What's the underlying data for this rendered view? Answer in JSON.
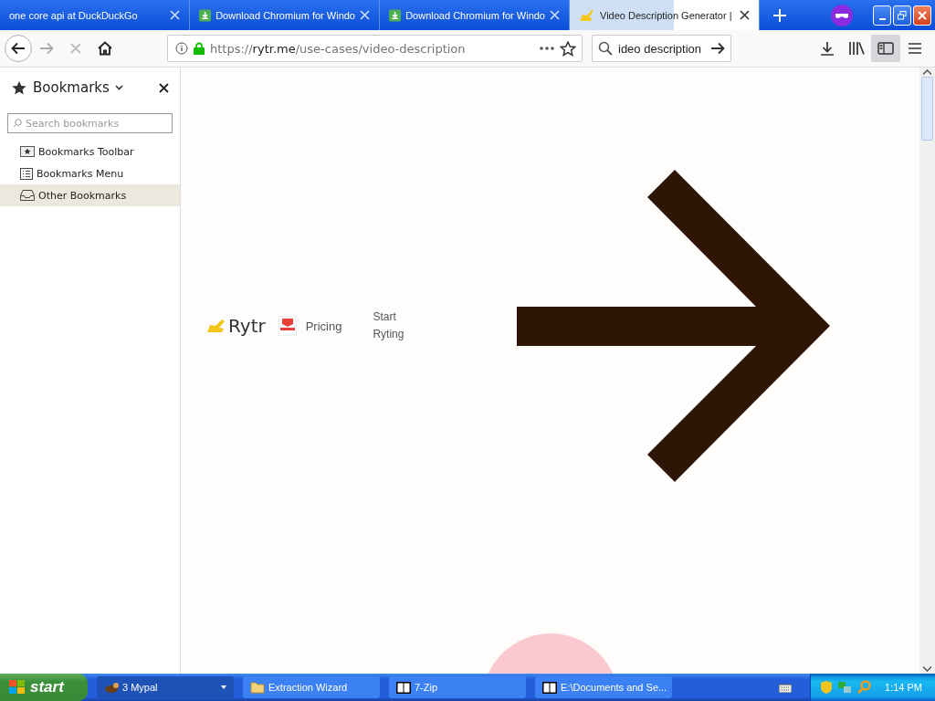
{
  "tabs": [
    {
      "title": "one core api at DuckDuckGo",
      "kind": "plain",
      "selected": false
    },
    {
      "title": "Download Chromium for Windo",
      "kind": "download",
      "selected": false
    },
    {
      "title": "Download Chromium for Windo",
      "kind": "download",
      "selected": false
    },
    {
      "title": "Video Description Generator |",
      "kind": "pen",
      "selected": true
    }
  ],
  "toolbar": {
    "url_host": "https://rytr.me",
    "url_path": "/use-cases/video-description",
    "search_value": "ideo description",
    "sidebar_on": true
  },
  "sidebar": {
    "title": "Bookmarks",
    "search": {
      "placeholder": "Search bookmarks"
    },
    "items": [
      {
        "label": "Bookmarks Toolbar",
        "kind": "toolbar",
        "selected": false
      },
      {
        "label": "Bookmarks Menu",
        "kind": "menu",
        "selected": false
      },
      {
        "label": "Other Bookmarks",
        "kind": "other",
        "selected": true
      }
    ]
  },
  "page": {
    "logo": "Rytr",
    "nav": [
      "Pricing",
      "Start Ryting"
    ]
  },
  "taskbar": {
    "start": "start",
    "tasks": [
      {
        "label": "3 Mypal",
        "kind": "browser",
        "selected": true
      },
      {
        "label": "Extraction Wizard",
        "kind": "folder",
        "selected": false
      },
      {
        "label": "7-Zip",
        "kind": "zip",
        "selected": false
      },
      {
        "label": "E:\\Documents and Se...",
        "kind": "zip",
        "selected": false
      }
    ],
    "clock": "1:14 PM"
  }
}
